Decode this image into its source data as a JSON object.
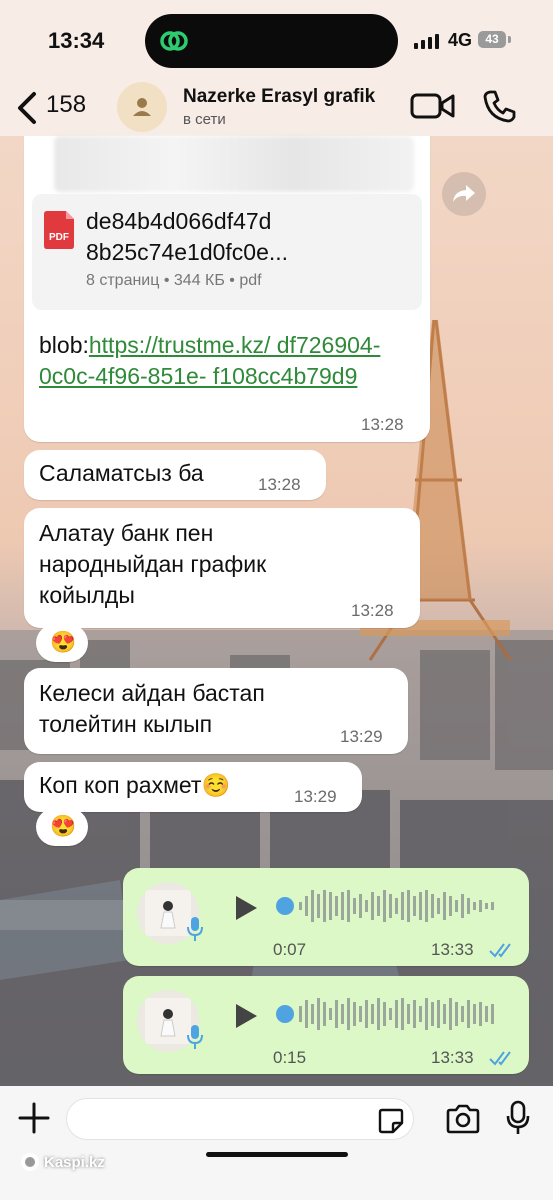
{
  "status_bar": {
    "time": "13:34",
    "network": "4G",
    "battery": "43"
  },
  "header": {
    "back_count": "158",
    "contact_name": "Nazerke Erasyl grafik",
    "contact_status": "в сети",
    "icons": [
      "chevron-left-icon",
      "avatar-icon",
      "video-icon",
      "phone-icon"
    ]
  },
  "messages": [
    {
      "type": "document",
      "file_name": "de84b4d066df47d 8b25c74e1d0fc0e...",
      "file_meta": "8 страниц • 344 КБ • pdf",
      "file_type": "PDF",
      "text_prefix": "blob:",
      "link": "https://trustme.kz/ df726904-0c0c-4f96-851e- f108cc4b79d9",
      "time": "13:28"
    },
    {
      "type": "text",
      "text": "Саламатсыз ба",
      "time": "13:28"
    },
    {
      "type": "text",
      "text": "Алатау банк пен народныйдан график койылды",
      "time": "13:28",
      "reaction": "😍"
    },
    {
      "type": "text",
      "text": "Келеси айдан бастап толейтин кылып",
      "time": "13:29"
    },
    {
      "type": "text",
      "text": "Коп коп рахмет☺️",
      "time": "13:29",
      "reaction": "😍"
    },
    {
      "type": "voice",
      "duration": "0:07",
      "time": "13:33",
      "status": "read"
    },
    {
      "type": "voice",
      "duration": "0:15",
      "time": "13:33",
      "status": "read"
    }
  ],
  "input": {
    "placeholder": "",
    "icons": [
      "plus-icon",
      "sticker-icon",
      "camera-icon",
      "microphone-icon"
    ]
  },
  "watermark": "Kaspi.kz",
  "colors": {
    "outgoing_bubble": "#dcf8c6",
    "link": "#2f8a3a",
    "read_ticks": "#4fa3e0"
  }
}
